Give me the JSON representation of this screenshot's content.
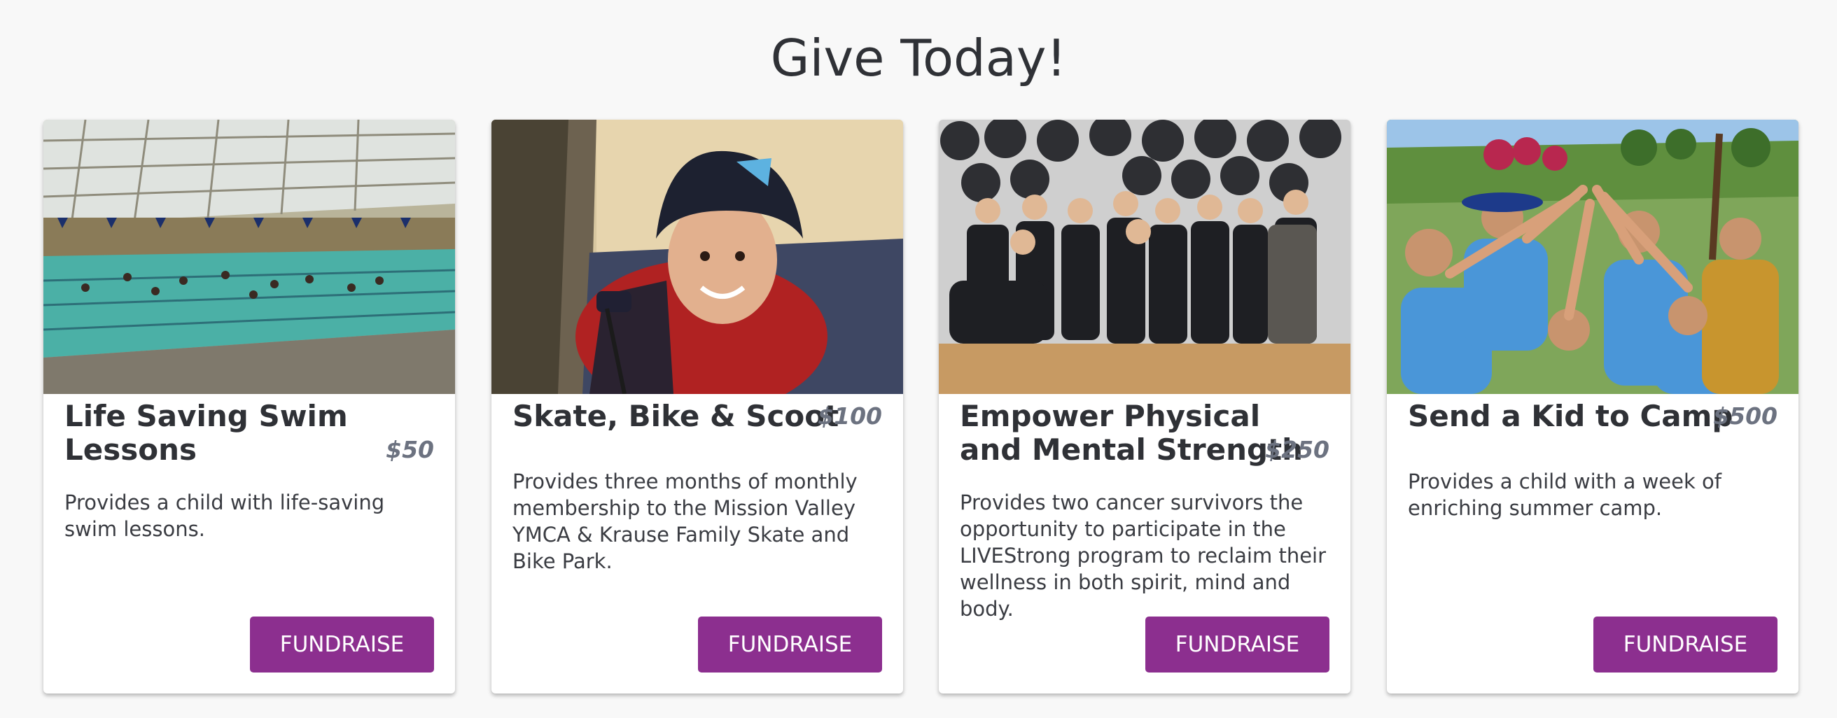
{
  "page": {
    "title": "Give Today!"
  },
  "cards": [
    {
      "title": "Life Saving Swim Lessons",
      "price": "$50",
      "description": "Provides a child with life-saving swim lessons.",
      "button_label": "FUNDRAISE",
      "image": "indoor-swimming-pool-photo"
    },
    {
      "title": "Skate, Bike & Scoot",
      "price": "$100",
      "description": "Provides three months of monthly membership to the Mission Valley YMCA & Krause Family Skate and Bike Park.",
      "button_label": "FUNDRAISE",
      "image": "smiling-boy-in-helmet-photo"
    },
    {
      "title": "Empower Physical and Mental Strength",
      "price": "$250",
      "description": "Provides two cancer survivors the opportunity to participate in the LIVEStrong program to reclaim their wellness in both spirit, mind and body.",
      "button_label": "FUNDRAISE",
      "image": "livestrong-group-flexing-photo"
    },
    {
      "title": "Send a Kid to Camp",
      "price": "$500",
      "description": "Provides a child with a week of enriching summer camp.",
      "button_label": "FUNDRAISE",
      "image": "campers-raising-hands-photo"
    }
  ],
  "colors": {
    "background": "#f8f8f8",
    "button": "#8c2f8f",
    "price": "#6c7280",
    "text": "#2f3136"
  }
}
